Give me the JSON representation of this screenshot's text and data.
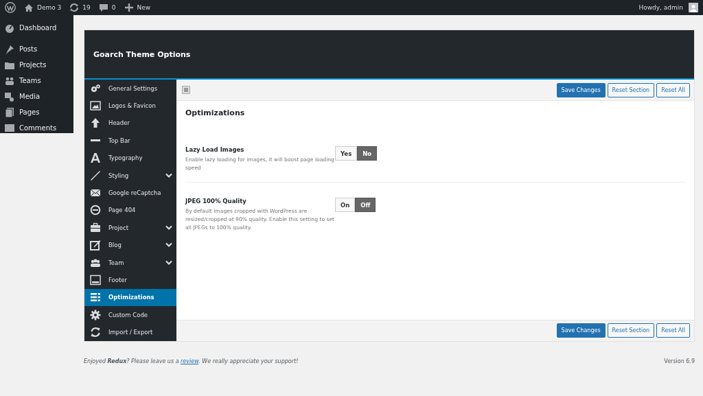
{
  "admin_bar": {
    "site": "Demo 3",
    "updates": "19",
    "comments": "0",
    "new": "New",
    "greeting": "Howdy, admin"
  },
  "admin_menu": [
    {
      "label": "Dashboard"
    },
    {
      "label": "Posts"
    },
    {
      "label": "Projects"
    },
    {
      "label": "Teams"
    },
    {
      "label": "Media"
    },
    {
      "label": "Pages"
    },
    {
      "label": "Comments"
    }
  ],
  "panel": {
    "title": "Goarch Theme Options",
    "sidebar": [
      {
        "label": "General Settings",
        "expandable": false,
        "selected": false
      },
      {
        "label": "Logos & Favicon",
        "expandable": false,
        "selected": false
      },
      {
        "label": "Header",
        "expandable": false,
        "selected": false
      },
      {
        "label": "Top Bar",
        "expandable": false,
        "selected": false
      },
      {
        "label": "Typography",
        "expandable": false,
        "selected": false
      },
      {
        "label": "Styling",
        "expandable": true,
        "selected": false
      },
      {
        "label": "Google reCaptcha",
        "expandable": false,
        "selected": false
      },
      {
        "label": "Page 404",
        "expandable": false,
        "selected": false
      },
      {
        "label": "Project",
        "expandable": true,
        "selected": false
      },
      {
        "label": "Blog",
        "expandable": true,
        "selected": false
      },
      {
        "label": "Team",
        "expandable": true,
        "selected": false
      },
      {
        "label": "Footer",
        "expandable": false,
        "selected": false
      },
      {
        "label": "Optimizations",
        "expandable": false,
        "selected": true
      },
      {
        "label": "Custom Code",
        "expandable": false,
        "selected": false
      },
      {
        "label": "Import / Export",
        "expandable": false,
        "selected": false
      }
    ],
    "buttons": [
      {
        "label": "Save Changes",
        "kind": "primary"
      },
      {
        "label": "Reset Section",
        "kind": "secondary"
      },
      {
        "label": "Reset All",
        "kind": "secondary"
      }
    ],
    "section_title": "Optimizations",
    "settings": [
      {
        "title": "Lazy Load Images",
        "description": "Enable lazy loading for images, it will boost page loading speed",
        "options": [
          {
            "label": "Yes",
            "selected": false
          },
          {
            "label": "No",
            "selected": true
          }
        ]
      },
      {
        "title": "JPEG 100% Quality",
        "description": "By default images cropped with WordPress are resized/cropped at 90% quality. Enable this setting to set all JPEGs to 100% quality.",
        "options": [
          {
            "label": "On",
            "selected": false
          },
          {
            "label": "Off",
            "selected": true
          }
        ]
      }
    ],
    "bottom_buttons": [
      {
        "label": "Save Changes",
        "kind": "primary"
      },
      {
        "label": "Reset Section",
        "kind": "secondary"
      },
      {
        "label": "Reset All",
        "kind": "secondary"
      }
    ]
  },
  "footer": {
    "before": "Enjoyed **Redux**? Please leave us a ",
    "link": "review",
    "after": ". We really appreciate your support!",
    "version": "Version 6.9"
  }
}
